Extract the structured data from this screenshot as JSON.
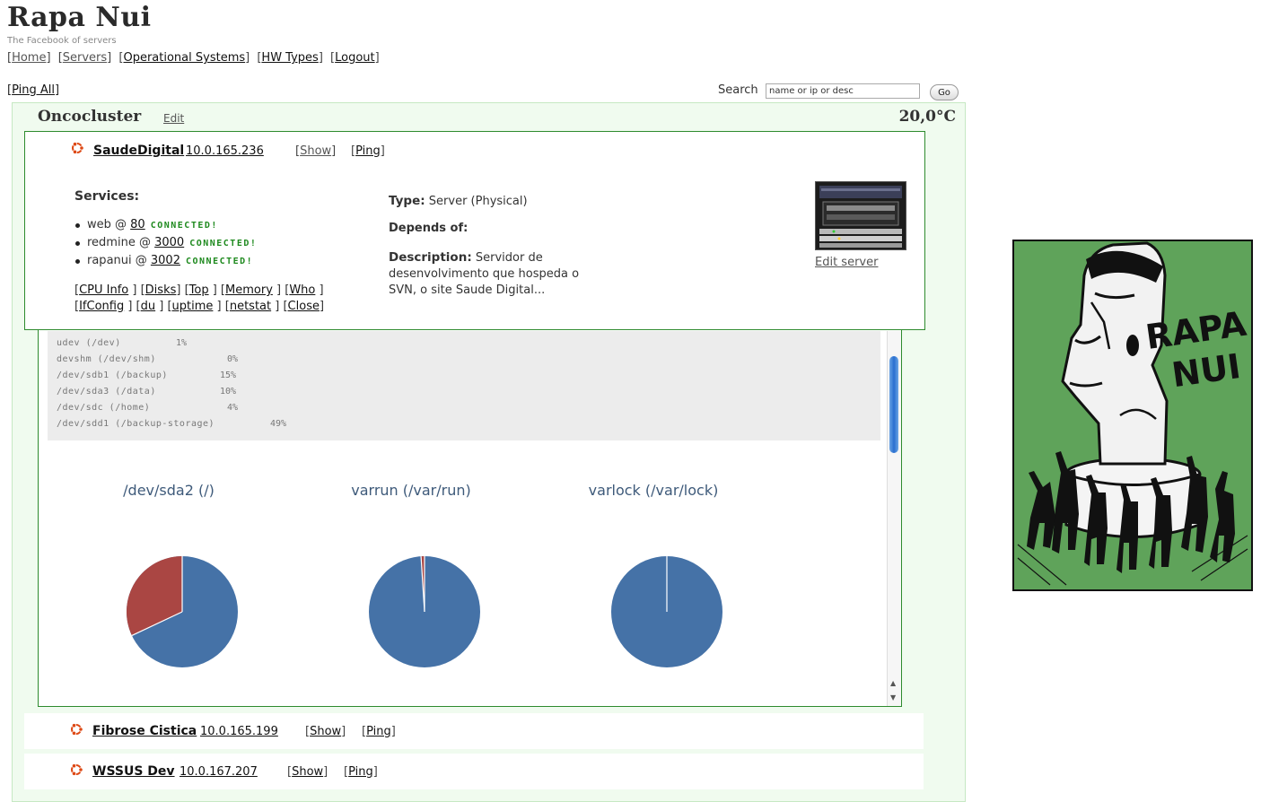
{
  "site": {
    "title": "Rapa Nui",
    "tagline": "The Facebook of servers"
  },
  "nav": {
    "items": [
      {
        "label": "Home"
      },
      {
        "label": "Servers"
      },
      {
        "label": "Operational Systems"
      },
      {
        "label": "HW Types"
      },
      {
        "label": "Logout"
      }
    ]
  },
  "toolbar": {
    "ping_all": "Ping All",
    "search_label": "Search",
    "search_placeholder": "name or ip or desc",
    "go_label": "Go"
  },
  "cluster": {
    "name": "Oncocluster",
    "edit_label": "Edit",
    "temperature": "20,0°C"
  },
  "server": {
    "name": "SaudeDigital",
    "ip": "10.0.165.236",
    "show_label": "Show",
    "ping_label": "Ping",
    "services_heading": "Services:",
    "services": [
      {
        "name": "web",
        "port": "80",
        "status": "CONNECTED!"
      },
      {
        "name": "redmine",
        "port": "3000",
        "status": "CONNECTED!"
      },
      {
        "name": "rapanui",
        "port": "3002",
        "status": "CONNECTED!"
      }
    ],
    "commands": [
      "CPU Info",
      "Disks",
      "Top",
      "Memory",
      "Who",
      "IfConfig",
      "du",
      "uptime",
      "netstat",
      "Close"
    ],
    "type_label": "Type:",
    "type_value": "Server (Physical)",
    "depends_label": "Depends of:",
    "description_label": "Description:",
    "description_value": "Servidor de desenvolvimento que hospeda o SVN, o site Saude Digital...",
    "edit_server_label": "Edit server"
  },
  "disks": {
    "lines": [
      {
        "mount": "udev (/dev)",
        "usage": "1%"
      },
      {
        "mount": "devshm (/dev/shm)",
        "usage": "0%"
      },
      {
        "mount": "/dev/sdb1 (/backup)",
        "usage": "15%"
      },
      {
        "mount": "/dev/sda3 (/data)",
        "usage": "10%"
      },
      {
        "mount": "/dev/sdc (/home)",
        "usage": "4%"
      },
      {
        "mount": "/dev/sdd1 (/backup-storage)",
        "usage": "49%"
      }
    ]
  },
  "chart_data": [
    {
      "type": "pie",
      "title": "/dev/sda2 (/)",
      "slices": [
        {
          "label": "used",
          "value": 32,
          "color": "#aa4643"
        },
        {
          "label": "free",
          "value": 68,
          "color": "#4572a7"
        }
      ]
    },
    {
      "type": "pie",
      "title": "varrun (/var/run)",
      "slices": [
        {
          "label": "used",
          "value": 1,
          "color": "#aa4643"
        },
        {
          "label": "free",
          "value": 99,
          "color": "#4572a7"
        }
      ]
    },
    {
      "type": "pie",
      "title": "varlock (/var/lock)",
      "slices": [
        {
          "label": "used",
          "value": 0,
          "color": "#aa4643"
        },
        {
          "label": "free",
          "value": 100,
          "color": "#4572a7"
        }
      ]
    }
  ],
  "other_servers": [
    {
      "name": "Fibrose Cistica",
      "ip": "10.0.165.199",
      "show_label": "Show",
      "ping_label": "Ping"
    },
    {
      "name": "WSSUS Dev",
      "ip": "10.0.167.207",
      "show_label": "Show",
      "ping_label": "Ping"
    }
  ],
  "logo": {
    "text_line1": "RAPA",
    "text_line2": "NUI",
    "background_color": "#5fa35a"
  }
}
